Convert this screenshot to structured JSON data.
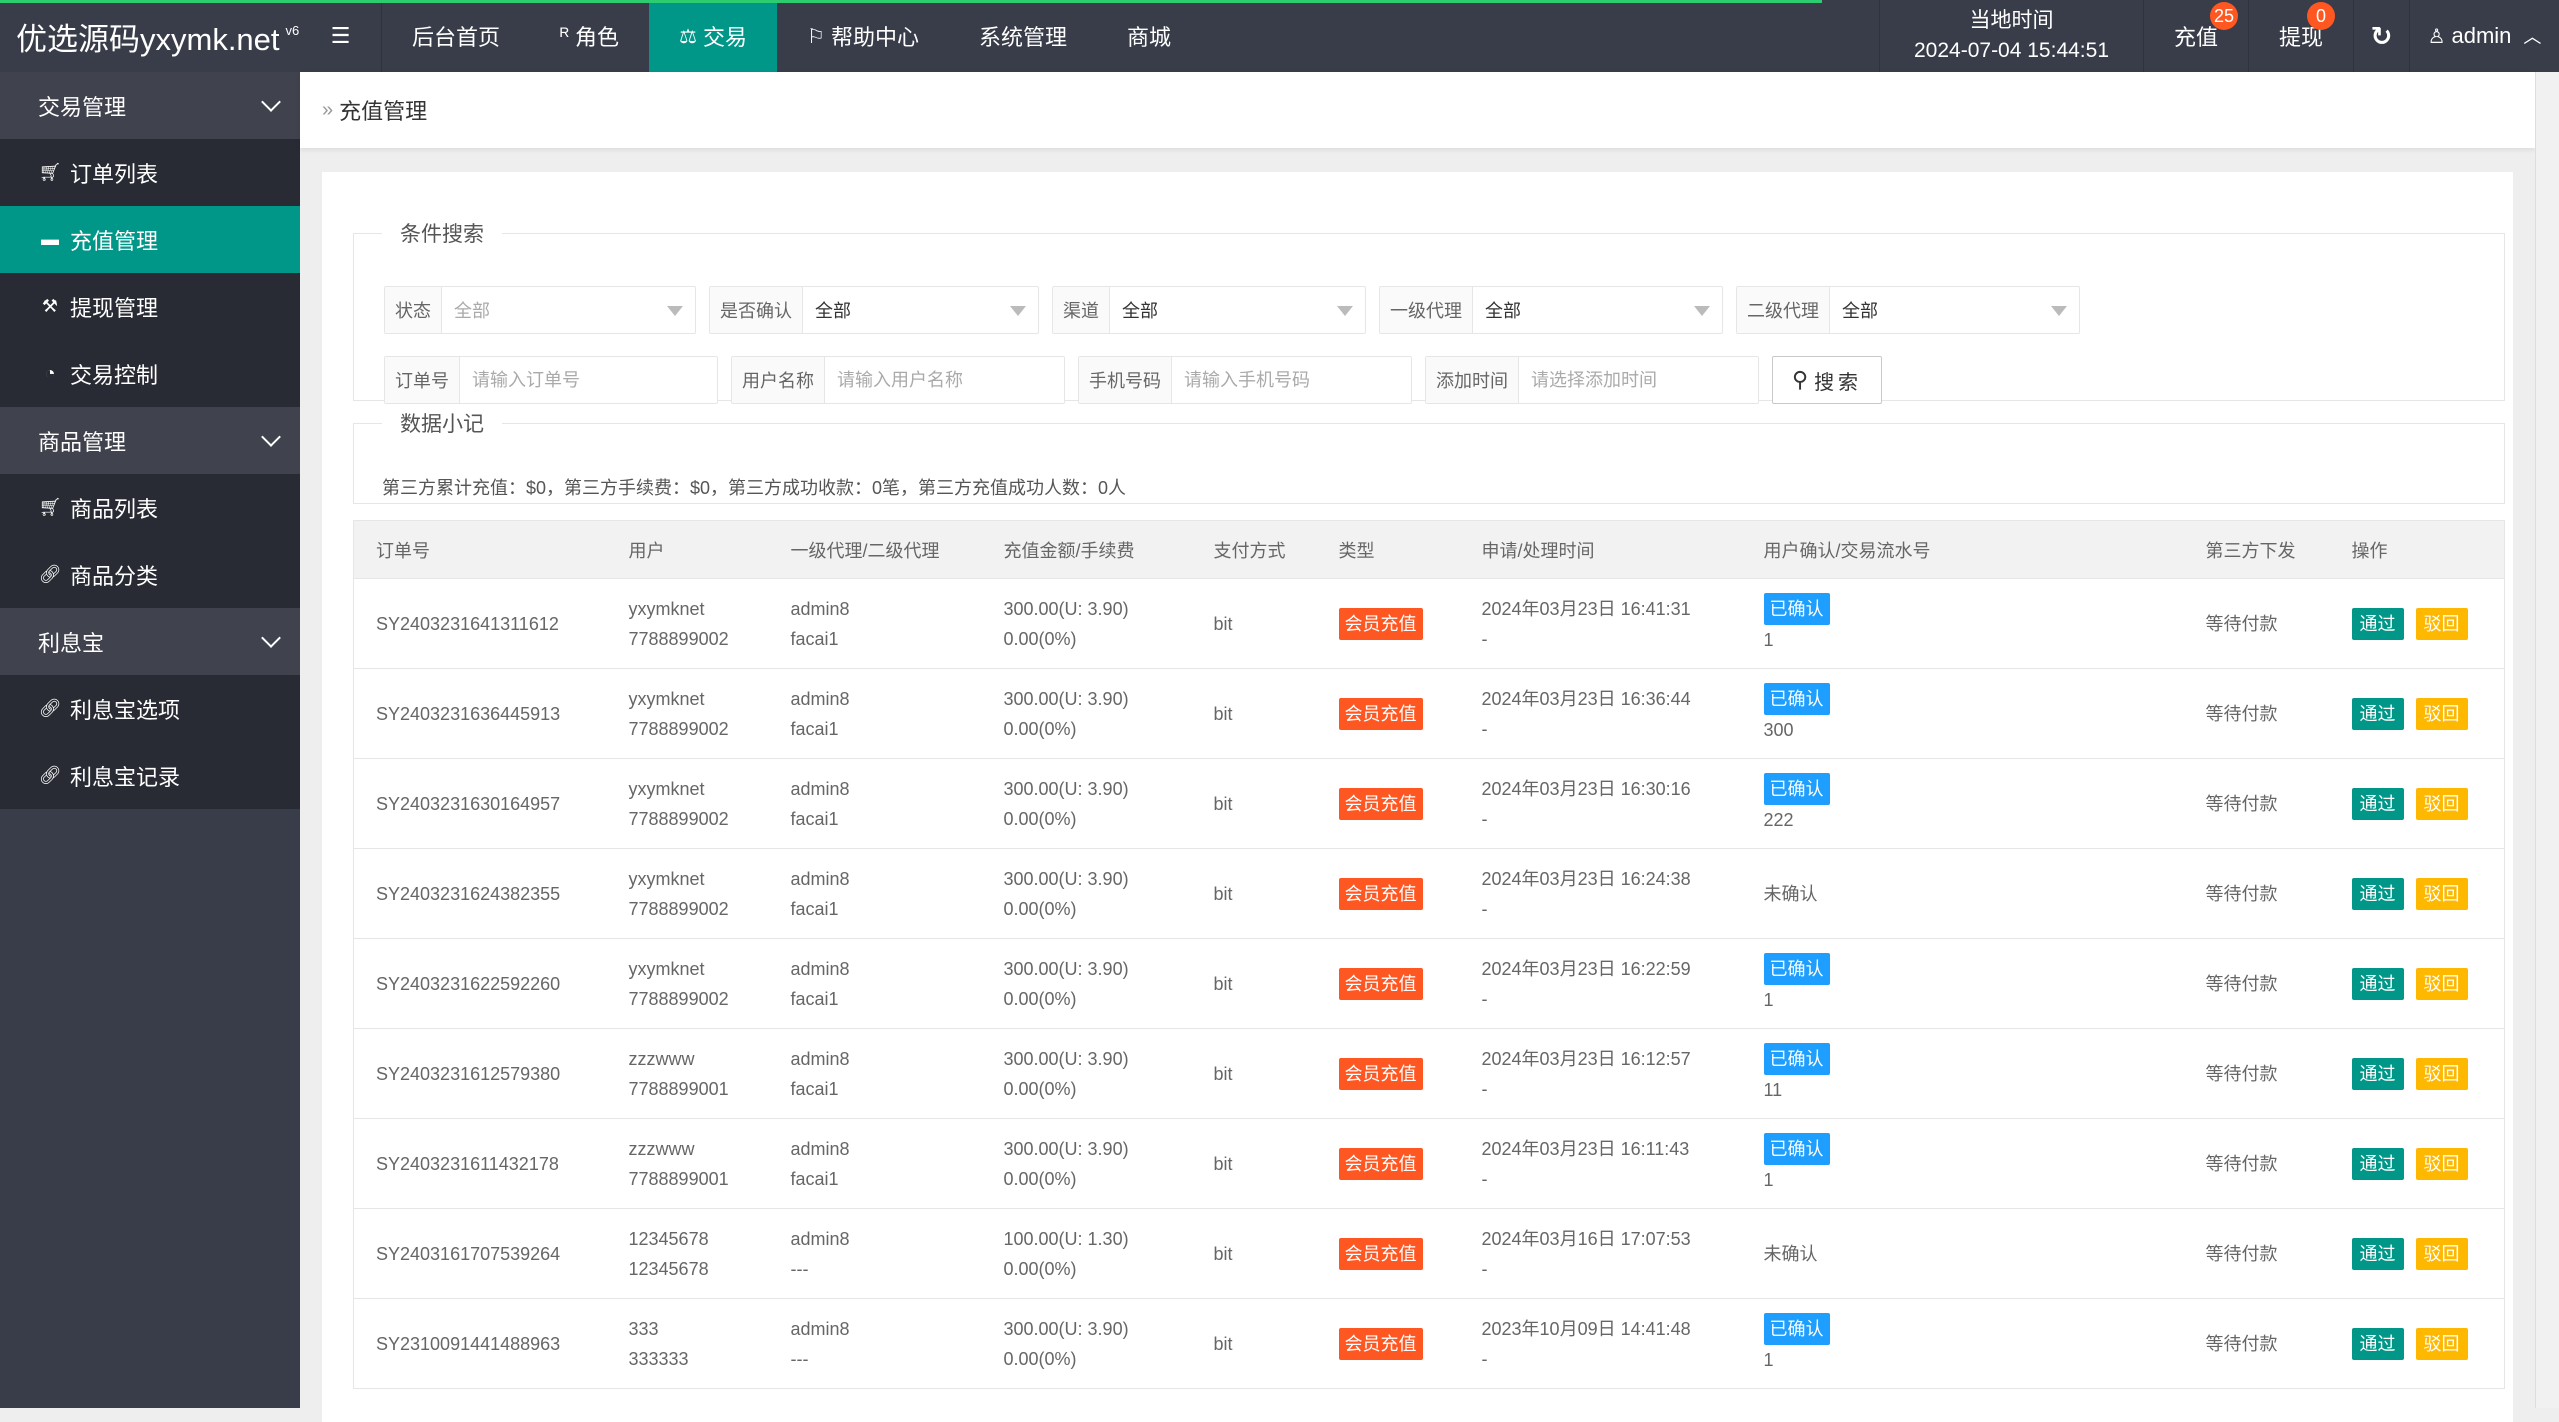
{
  "app": {
    "logo": "优选源码yxymk.net",
    "logo_version": "v6",
    "menu_toggle_icon": "menu-toggle-icon"
  },
  "topnav": {
    "items": [
      {
        "label": "后台首页",
        "icon": ""
      },
      {
        "label": "角色",
        "icon": "user-icon"
      },
      {
        "label": "交易",
        "icon": "scale-icon",
        "active": true
      },
      {
        "label": "帮助中心",
        "icon": "flag-icon"
      },
      {
        "label": "系统管理",
        "icon": ""
      },
      {
        "label": "商城",
        "icon": ""
      }
    ],
    "clock_label": "当地时间",
    "clock_value": "2024-07-04 15:44:51",
    "recharge_label": "充值",
    "recharge_count": "25",
    "withdraw_label": "提现",
    "withdraw_count": "0",
    "refresh_icon": "refresh-icon",
    "user_label": "admin"
  },
  "sidebar": {
    "groups": [
      {
        "label": "交易管理",
        "items": [
          {
            "label": "订单列表",
            "icon": "cart-icon"
          },
          {
            "label": "充值管理",
            "icon": "monitor-icon",
            "active": true
          },
          {
            "label": "提现管理",
            "icon": "hammer-icon"
          },
          {
            "label": "交易控制",
            "icon": "gauge-icon"
          }
        ]
      },
      {
        "label": "商品管理",
        "items": [
          {
            "label": "商品列表",
            "icon": "cart-icon"
          },
          {
            "label": "商品分类",
            "icon": "link-icon"
          }
        ]
      },
      {
        "label": "利息宝",
        "items": [
          {
            "label": "利息宝选项",
            "icon": "link-icon"
          },
          {
            "label": "利息宝记录",
            "icon": "link-icon"
          }
        ]
      }
    ]
  },
  "breadcrumb": {
    "current": "充值管理"
  },
  "search": {
    "legend": "条件搜索",
    "selects": [
      {
        "label": "状态",
        "value": "全部",
        "placeholder": true
      },
      {
        "label": "是否确认",
        "value": "全部"
      },
      {
        "label": "渠道",
        "value": "全部"
      },
      {
        "label": "一级代理",
        "value": "全部"
      },
      {
        "label": "二级代理",
        "value": "全部"
      }
    ],
    "inputs": [
      {
        "label": "订单号",
        "placeholder": "请输入订单号",
        "value": ""
      },
      {
        "label": "用户名称",
        "placeholder": "请输入用户名称",
        "value": ""
      },
      {
        "label": "手机号码",
        "placeholder": "请输入手机号码",
        "value": ""
      },
      {
        "label": "添加时间",
        "placeholder": "请选择添加时间",
        "value": ""
      }
    ],
    "button_label": "搜索"
  },
  "stats": {
    "legend": "数据小记",
    "text": "第三方累计充值：$0，第三方手续费：$0，第三方成功收款：0笔，第三方充值成功人数：0人"
  },
  "table": {
    "headers": [
      "订单号",
      "用户",
      "一级代理/二级代理",
      "充值金额/手续费",
      "支付方式",
      "类型",
      "申请/处理时间",
      "用户确认/交易流水号",
      "第三方下发",
      "操作"
    ],
    "type_label": "会员充值",
    "confirmed_label": "已确认",
    "unconfirmed_label": "未确认",
    "pass_label": "通过",
    "reject_label": "驳回",
    "rows": [
      {
        "order": "SY2403231641311612",
        "user": "yxymknet",
        "phone": "7788899002",
        "agent1": "admin8",
        "agent2": "facai1",
        "amount": "300.00(U: 3.90)",
        "fee": "0.00(0%)",
        "pay": "bit",
        "apply_time": "2024年03月23日 16:41:31",
        "process_time": "-",
        "confirmed": true,
        "serial": "1",
        "third": "等待付款"
      },
      {
        "order": "SY2403231636445913",
        "user": "yxymknet",
        "phone": "7788899002",
        "agent1": "admin8",
        "agent2": "facai1",
        "amount": "300.00(U: 3.90)",
        "fee": "0.00(0%)",
        "pay": "bit",
        "apply_time": "2024年03月23日 16:36:44",
        "process_time": "-",
        "confirmed": true,
        "serial": "300",
        "third": "等待付款"
      },
      {
        "order": "SY2403231630164957",
        "user": "yxymknet",
        "phone": "7788899002",
        "agent1": "admin8",
        "agent2": "facai1",
        "amount": "300.00(U: 3.90)",
        "fee": "0.00(0%)",
        "pay": "bit",
        "apply_time": "2024年03月23日 16:30:16",
        "process_time": "-",
        "confirmed": true,
        "serial": "222",
        "third": "等待付款"
      },
      {
        "order": "SY2403231624382355",
        "user": "yxymknet",
        "phone": "7788899002",
        "agent1": "admin8",
        "agent2": "facai1",
        "amount": "300.00(U: 3.90)",
        "fee": "0.00(0%)",
        "pay": "bit",
        "apply_time": "2024年03月23日 16:24:38",
        "process_time": "-",
        "confirmed": false,
        "serial": "",
        "third": "等待付款"
      },
      {
        "order": "SY2403231622592260",
        "user": "yxymknet",
        "phone": "7788899002",
        "agent1": "admin8",
        "agent2": "facai1",
        "amount": "300.00(U: 3.90)",
        "fee": "0.00(0%)",
        "pay": "bit",
        "apply_time": "2024年03月23日 16:22:59",
        "process_time": "-",
        "confirmed": true,
        "serial": "1",
        "third": "等待付款"
      },
      {
        "order": "SY2403231612579380",
        "user": "zzzwww",
        "phone": "7788899001",
        "agent1": "admin8",
        "agent2": "facai1",
        "amount": "300.00(U: 3.90)",
        "fee": "0.00(0%)",
        "pay": "bit",
        "apply_time": "2024年03月23日 16:12:57",
        "process_time": "-",
        "confirmed": true,
        "serial": "11",
        "third": "等待付款"
      },
      {
        "order": "SY2403231611432178",
        "user": "zzzwww",
        "phone": "7788899001",
        "agent1": "admin8",
        "agent2": "facai1",
        "amount": "300.00(U: 3.90)",
        "fee": "0.00(0%)",
        "pay": "bit",
        "apply_time": "2024年03月23日 16:11:43",
        "process_time": "-",
        "confirmed": true,
        "serial": "1",
        "third": "等待付款"
      },
      {
        "order": "SY2403161707539264",
        "user": "12345678",
        "phone": "12345678",
        "agent1": "admin8",
        "agent2": "---",
        "amount": "100.00(U: 1.30)",
        "fee": "0.00(0%)",
        "pay": "bit",
        "apply_time": "2024年03月16日 17:07:53",
        "process_time": "-",
        "confirmed": false,
        "serial": "",
        "third": "等待付款"
      },
      {
        "order": "SY2310091441488963",
        "user": "333",
        "phone": "333333",
        "agent1": "admin8",
        "agent2": "---",
        "amount": "300.00(U: 3.90)",
        "fee": "0.00(0%)",
        "pay": "bit",
        "apply_time": "2023年10月09日 14:41:48",
        "process_time": "-",
        "confirmed": true,
        "serial": "1",
        "third": "等待付款"
      }
    ]
  },
  "colors": {
    "topbar": "#393d49",
    "accent": "#009688",
    "type_badge": "#ff5722",
    "confirm_badge": "#1e9fff",
    "reject_button": "#ffb800",
    "progress": "#2ecc71"
  }
}
